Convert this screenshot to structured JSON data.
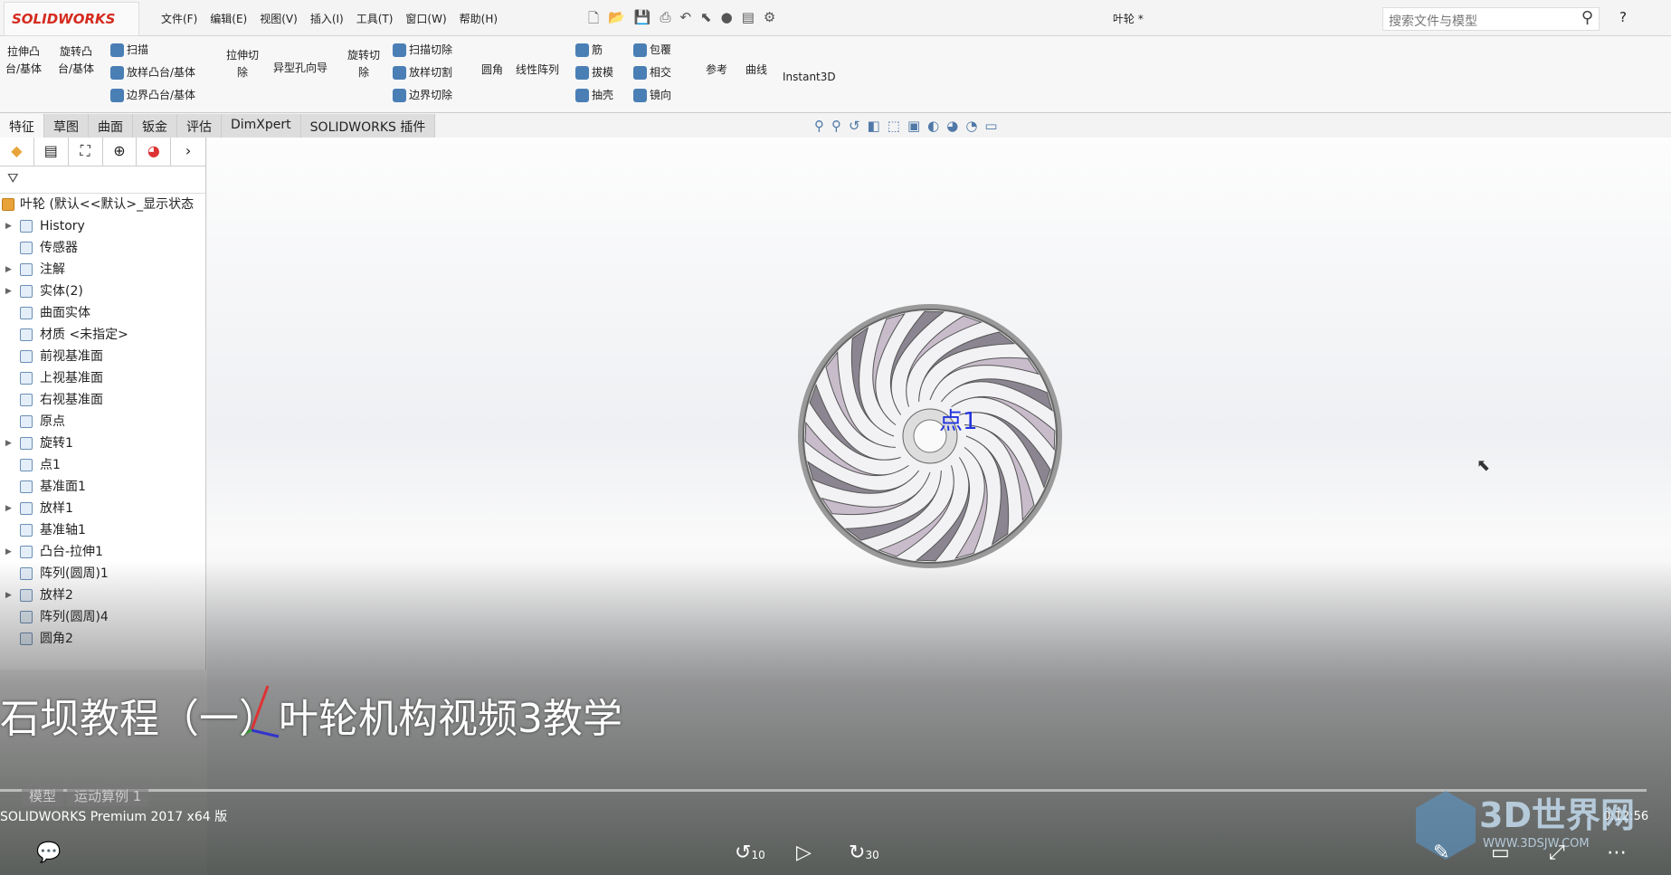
{
  "app": {
    "logo": "SOLIDWORKS",
    "title": "叶轮 *",
    "menu": [
      "文件(F)",
      "编辑(E)",
      "视图(V)",
      "插入(I)",
      "工具(T)",
      "窗口(W)",
      "帮助(H)"
    ],
    "search_placeholder": "搜索文件与模型",
    "help": "?"
  },
  "ribbon": {
    "extrude_boss": "拉伸凸\n台/基体",
    "revolve_boss": "旋转凸\n台/基体",
    "sweep": "扫描",
    "loft_boss": "放样凸台/基体",
    "boundary_boss": "边界凸台/基体",
    "extrude_cut": "拉伸切\n除",
    "hole_wizard": "异型孔向导",
    "revolve_cut": "旋转切\n除",
    "swept_cut": "扫描切除",
    "lofted_cut": "放样切割",
    "boundary_cut": "边界切除",
    "fillet": "圆角",
    "linear_pattern": "线性阵列",
    "rib": "筋",
    "draft": "拔模",
    "shell": "抽壳",
    "wrap": "包覆",
    "intersect": "相交",
    "mirror": "镜向",
    "reference": "参考",
    "curves": "曲线",
    "instant3d": "Instant3D"
  },
  "tabs": [
    "特征",
    "草图",
    "曲面",
    "钣金",
    "评估",
    "DimXpert",
    "SOLIDWORKS 插件"
  ],
  "tree": {
    "root": "叶轮 (默认<<默认>_显示状态",
    "items": [
      {
        "label": "History",
        "exp": true
      },
      {
        "label": "传感器",
        "exp": false
      },
      {
        "label": "注解",
        "exp": true
      },
      {
        "label": "实体(2)",
        "exp": true
      },
      {
        "label": "曲面实体",
        "exp": false
      },
      {
        "label": "材质 <未指定>",
        "exp": false
      },
      {
        "label": "前视基准面",
        "exp": false
      },
      {
        "label": "上视基准面",
        "exp": false
      },
      {
        "label": "右视基准面",
        "exp": false
      },
      {
        "label": "原点",
        "exp": false
      },
      {
        "label": "旋转1",
        "exp": true
      },
      {
        "label": "点1",
        "exp": false
      },
      {
        "label": "基准面1",
        "exp": false
      },
      {
        "label": "放样1",
        "exp": true
      },
      {
        "label": "基准轴1",
        "exp": false
      },
      {
        "label": "凸台-拉伸1",
        "exp": true
      },
      {
        "label": "阵列(圆周)1",
        "exp": false
      },
      {
        "label": "放样2",
        "exp": true
      },
      {
        "label": "阵列(圆周)4",
        "exp": false
      },
      {
        "label": "圆角2",
        "exp": false
      }
    ]
  },
  "viewport": {
    "point_label": "点1"
  },
  "subtitle": "石坝教程（一）叶轮机构视频3教学",
  "bottom_tabs": [
    "模型",
    "运动算例 1"
  ],
  "status": "SOLIDWORKS Premium 2017 x64 版",
  "video": {
    "time": "0:12:56",
    "rewind": "10",
    "forward": "30"
  },
  "watermark": {
    "name": "3D世界网",
    "url": "WWW.3DSJW.COM"
  }
}
